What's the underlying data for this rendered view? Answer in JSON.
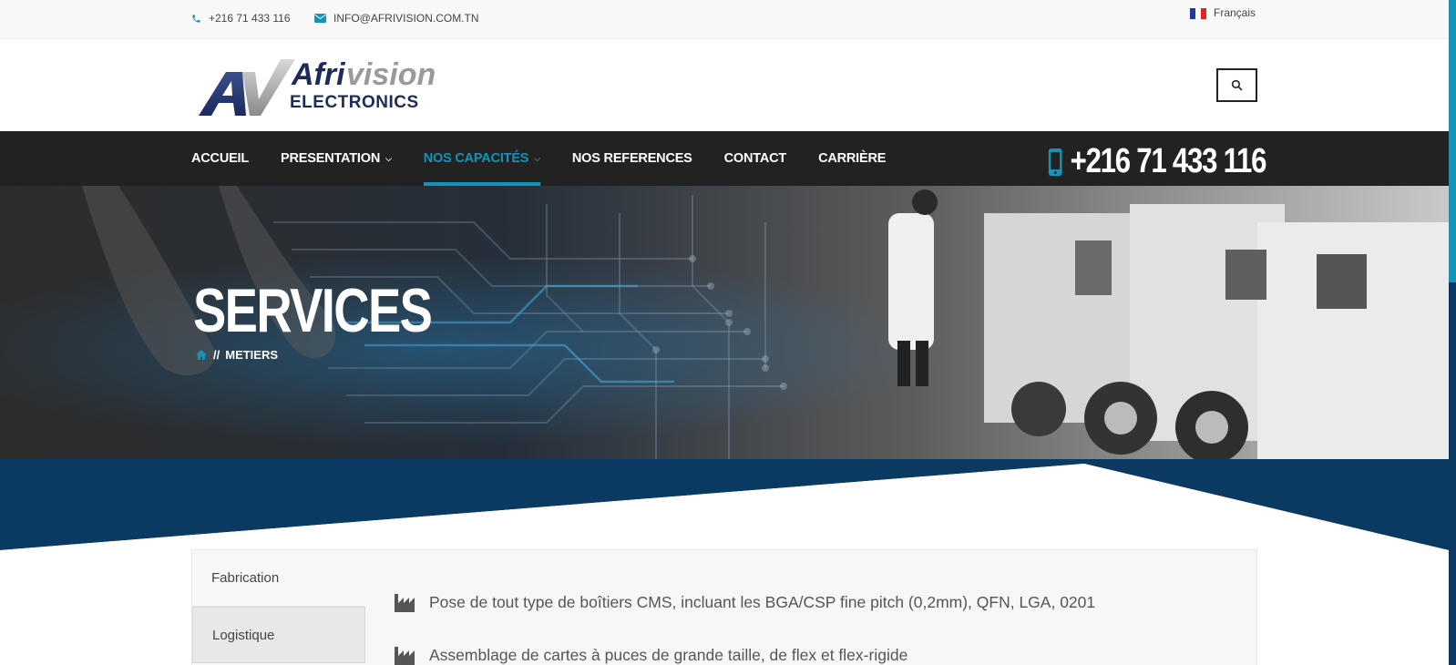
{
  "topbar": {
    "phone": "+216 71 433 116",
    "email": "INFO@AFRIVISION.COM.TN",
    "language": "Français",
    "flag_colors": [
      "#1f3a93",
      "#ffffff",
      "#e1261c"
    ]
  },
  "header": {
    "logo_text_1": "Afri",
    "logo_text_2": "vision",
    "logo_subtext": "ELECTRONICS",
    "logo_initials": "AV",
    "search_icon": "search-icon"
  },
  "nav": {
    "items": [
      {
        "label": "ACCUEIL",
        "has_dropdown": false
      },
      {
        "label": "PRESENTATION",
        "has_dropdown": true
      },
      {
        "label": "NOS CAPACITÉS",
        "has_dropdown": true,
        "active": true
      },
      {
        "label": "NOS REFERENCES",
        "has_dropdown": false
      },
      {
        "label": "CONTACT",
        "has_dropdown": false
      },
      {
        "label": "CARRIÈRE",
        "has_dropdown": false
      }
    ],
    "phone": "+216 71 433 116",
    "chevron": "⌄"
  },
  "hero": {
    "title": "SERVICES",
    "breadcrumb_sep": "//",
    "breadcrumb_current": "METIERS"
  },
  "content": {
    "tabs": [
      {
        "label": "Fabrication"
      },
      {
        "label": "Logistique"
      }
    ],
    "features": [
      "Pose de tout type de boîtiers CMS, incluant les BGA/CSP fine pitch (0,2mm), QFN, LGA, 0201",
      "Assemblage de cartes à puces de grande taille, de flex et flex-rigide"
    ]
  },
  "colors": {
    "accent": "#1793b9",
    "navy": "#0a3961",
    "nav_bg": "#222222"
  }
}
